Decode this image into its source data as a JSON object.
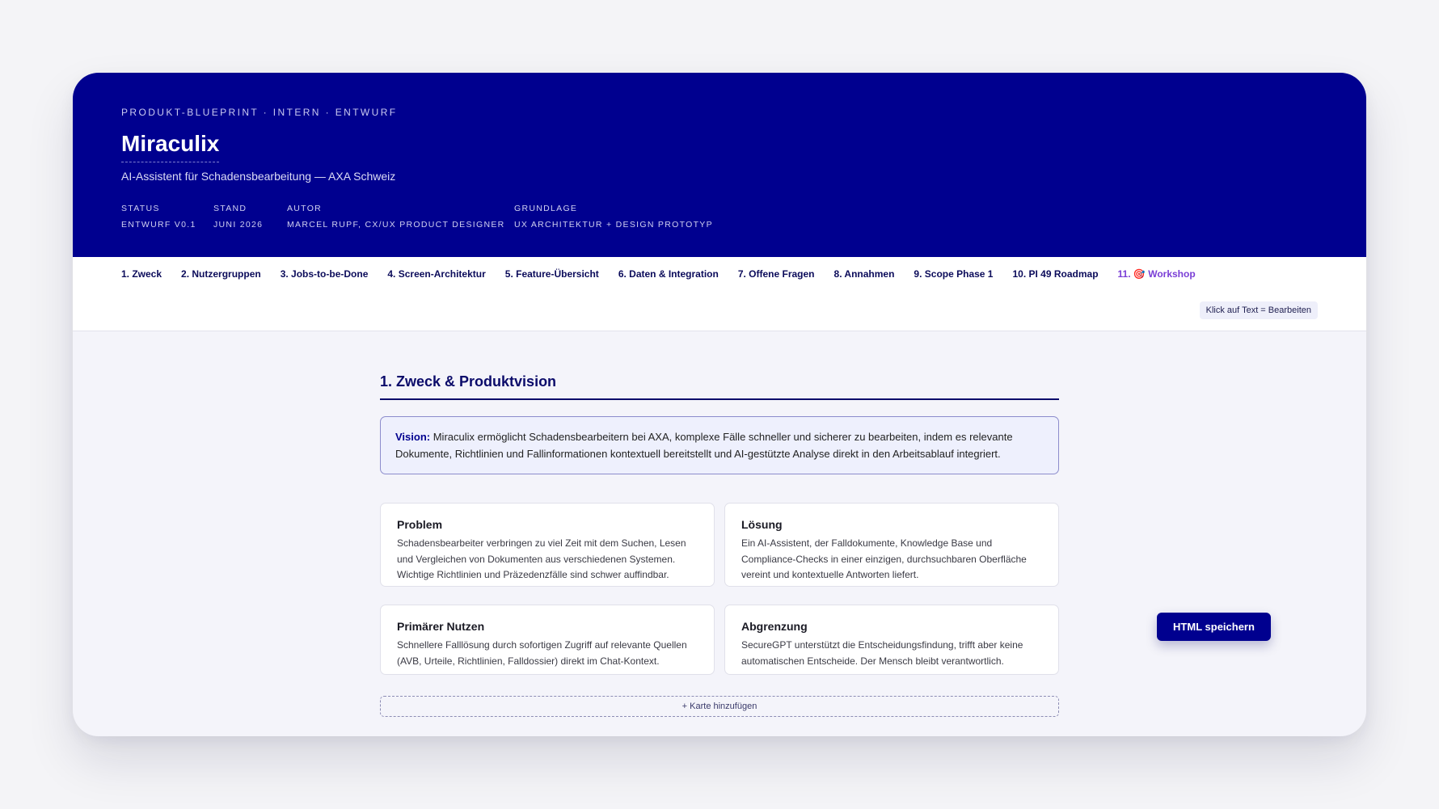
{
  "hero": {
    "eyebrow": "PRODUKT-BLUEPRINT · INTERN · ENTWURF",
    "title": "Miraculix",
    "subtitle": "AI-Assistent für Schadensbearbeitung — AXA Schweiz",
    "meta": [
      {
        "label": "STATUS",
        "value": "ENTWURF V0.1"
      },
      {
        "label": "STAND",
        "value": "JUNI 2026"
      },
      {
        "label": "AUTOR",
        "value": "MARCEL RUPF, CX/UX PRODUCT DESIGNER"
      },
      {
        "label": "GRUNDLAGE",
        "value": "UX ARCHITEKTUR + DESIGN PROTOTYP"
      }
    ]
  },
  "nav": {
    "items": [
      "1. Zweck",
      "2. Nutzergruppen",
      "3. Jobs-to-be-Done",
      "4. Screen-Architektur",
      "5. Feature-Übersicht",
      "6. Daten & Integration",
      "7. Offene Fragen",
      "8. Annahmen",
      "9. Scope Phase 1",
      "10. PI 49 Roadmap"
    ],
    "workshop_prefix": "11.",
    "workshop_label": "Workshop",
    "edit_hint": "Klick auf Text = Bearbeiten"
  },
  "section": {
    "title": "1. Zweck & Produktvision",
    "vision_label": "Vision:",
    "vision_text": " Miraculix ermöglicht Schadensbearbeitern bei AXA, komplexe Fälle schneller und sicherer zu bearbeiten, indem es relevante Dokumente, Richtlinien und Fallinformationen kontextuell bereitstellt und AI-gestützte Analyse direkt in den Arbeitsablauf integriert.",
    "cards": [
      {
        "title": "Problem",
        "text": "Schadensbearbeiter verbringen zu viel Zeit mit dem Suchen, Lesen und Vergleichen von Dokumenten aus verschiedenen Systemen. Wichtige Richtlinien und Präzedenzfälle sind schwer auffindbar."
      },
      {
        "title": "Lösung",
        "text": "Ein AI-Assistent, der Falldokumente, Knowledge Base und Compliance-Checks in einer einzigen, durchsuchbaren Oberfläche vereint und kontextuelle Antworten liefert."
      },
      {
        "title": "Primärer Nutzen",
        "text": "Schnellere Falllösung durch sofortigen Zugriff auf relevante Quellen (AVB, Urteile, Richtlinien, Falldossier) direkt im Chat-Kontext."
      },
      {
        "title": "Abgrenzung",
        "text": "SecureGPT unterstützt die Entscheidungsfindung, trifft aber keine automatischen Entscheide. Der Mensch bleibt verantwortlich."
      }
    ],
    "add_card_label": "+ Karte hinzufügen"
  },
  "actions": {
    "save_label": "HTML speichern"
  },
  "colors": {
    "brand": "#00008f",
    "workshop_accent": "#7a3ed6"
  }
}
